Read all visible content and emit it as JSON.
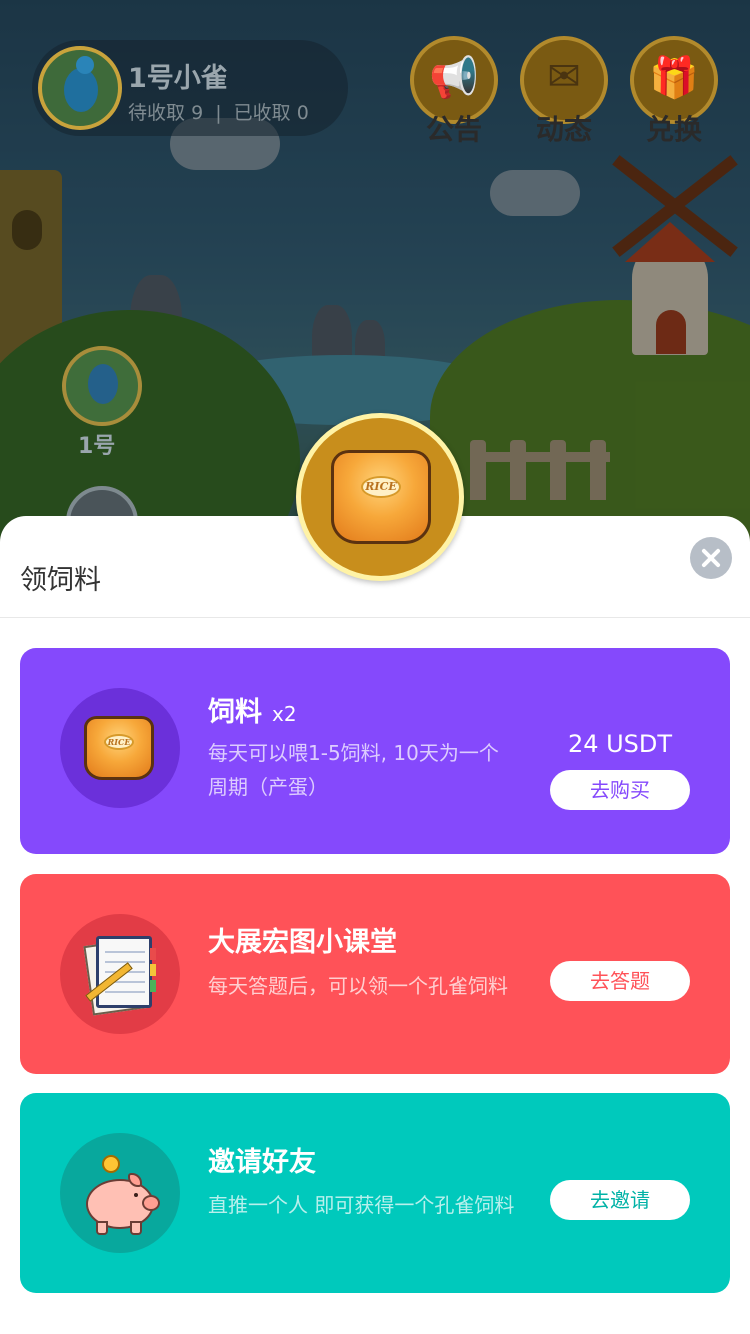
{
  "header": {
    "user_name": "1号小雀",
    "pending_label": "待收取",
    "pending_count": "9",
    "separator": "|",
    "collected_label": "已收取",
    "collected_count": "0"
  },
  "top_buttons": [
    {
      "label": "公告",
      "icon": "megaphone-icon"
    },
    {
      "label": "动态",
      "icon": "news-icon"
    },
    {
      "label": "兑换",
      "icon": "gift-icon"
    }
  ],
  "side": {
    "peacock_label": "1号"
  },
  "modal": {
    "title": "领饲料",
    "close_icon": "close-icon",
    "badge_icon": "rice-bag-icon",
    "bag_text": "RICE"
  },
  "cards": [
    {
      "title": "饲料",
      "quantity": "x2",
      "description": "每天可以喂1-5饲料, 10天为一个周期（产蛋）",
      "price": "24 USDT",
      "button": "去购买",
      "icon": "rice-bag-icon",
      "color": "#8549fc"
    },
    {
      "title": "大展宏图小课堂",
      "description": "每天答题后，可以领一个孔雀饲料",
      "button": "去答题",
      "icon": "notebook-icon",
      "color": "#ff5258"
    },
    {
      "title": "邀请好友",
      "description": "直推一个人 即可获得一个孔雀饲料",
      "button": "去邀请",
      "icon": "piggy-bank-icon",
      "color": "#00c9bc"
    }
  ]
}
